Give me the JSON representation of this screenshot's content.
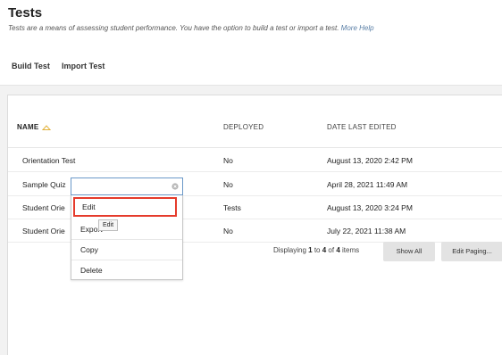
{
  "page": {
    "title": "Tests",
    "description": "Tests are a means of assessing student performance. You have the option to build a test or import a test.",
    "more_help": "More Help"
  },
  "actions": {
    "build": "Build Test",
    "import": "Import Test"
  },
  "table": {
    "headers": {
      "name": "NAME",
      "deployed": "DEPLOYED",
      "date": "DATE LAST EDITED"
    },
    "rows": [
      {
        "name": "Orientation Test",
        "deployed": "No",
        "date": "August 13, 2020 2:42 PM"
      },
      {
        "name": "Sample Quiz",
        "deployed": "No",
        "date": "April 28, 2021 11:49 AM"
      },
      {
        "name": "Student Orie",
        "deployed": "Tests",
        "date": "August 13, 2020 3:24 PM"
      },
      {
        "name": "Student Orie",
        "deployed": "No",
        "date": "July 22, 2021 11:38 AM"
      }
    ]
  },
  "paging": {
    "prefix": "Displaying",
    "from": "1",
    "to_word": "to",
    "to": "4",
    "of_word": "of",
    "total": "4",
    "suffix": "items",
    "show_all": "Show All",
    "edit_paging": "Edit Paging..."
  },
  "context_menu": {
    "items": [
      "Edit",
      "Export",
      "Copy",
      "Delete"
    ],
    "tooltip": "Edit"
  },
  "colors": {
    "highlight": "#e53b2c",
    "link": "#5a7fa6",
    "focus_border": "#6a98c8"
  },
  "icons": {
    "sort": "sort-ascending-icon",
    "clear": "clear-circle-icon"
  }
}
